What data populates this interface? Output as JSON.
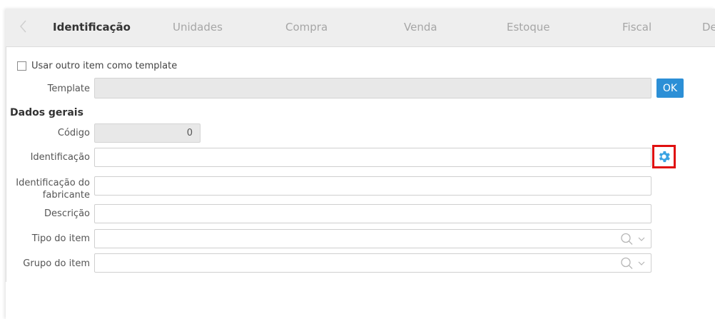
{
  "tabs": [
    "Identificação",
    "Unidades",
    "Compra",
    "Venda",
    "Estoque",
    "Fiscal",
    "De"
  ],
  "template_checkbox_label": "Usar outro item como template",
  "template_label": "Template",
  "ok_label": "OK",
  "section_title": "Dados gerais",
  "fields": {
    "codigo_label": "Código",
    "codigo_value": "0",
    "identificacao_label": "Identificação",
    "fabricante_label_line1": "Identificação do",
    "fabricante_label_line2": "fabricante",
    "descricao_label": "Descrição",
    "tipo_label": "Tipo do item",
    "grupo_label": "Grupo do item"
  },
  "colors": {
    "accent": "#2c8fd6",
    "highlight": "#e01010",
    "gear": "#3aa3e3"
  },
  "icons": {
    "gear": "gear-icon",
    "search": "search-icon",
    "chevron": "chevron-down-icon",
    "back": "chevron-left-icon"
  }
}
